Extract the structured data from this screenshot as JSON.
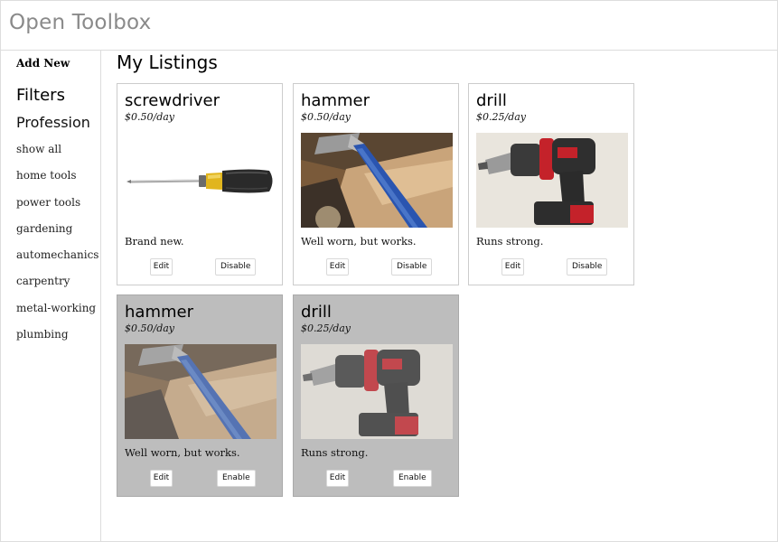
{
  "app": {
    "title": "Open Toolbox"
  },
  "sidebar": {
    "add_new_label": "Add New",
    "filters_title": "Filters",
    "profession_title": "Profession",
    "items": [
      "show all",
      "home tools",
      "power tools",
      "gardening",
      "automechanics",
      "carpentry",
      "metal-working",
      "plumbing"
    ]
  },
  "main": {
    "title": "My Listings",
    "listings": [
      {
        "name": "screwdriver",
        "price": "$0.50/day",
        "description": "Brand new.",
        "image": "screwdriver-photo",
        "edit_label": "Edit",
        "toggle_label": "Disable",
        "disabled": false
      },
      {
        "name": "hammer",
        "price": "$0.50/day",
        "description": "Well worn, but works.",
        "image": "hammer-photo",
        "edit_label": "Edit",
        "toggle_label": "Disable",
        "disabled": false
      },
      {
        "name": "drill",
        "price": "$0.25/day",
        "description": "Runs strong.",
        "image": "drill-photo",
        "edit_label": "Edit",
        "toggle_label": "Disable",
        "disabled": false
      },
      {
        "name": "hammer",
        "price": "$0.50/day",
        "description": "Well worn, but works.",
        "image": "hammer-photo",
        "edit_label": "Edit",
        "toggle_label": "Enable",
        "disabled": true
      },
      {
        "name": "drill",
        "price": "$0.25/day",
        "description": "Runs strong.",
        "image": "drill-photo",
        "edit_label": "Edit",
        "toggle_label": "Enable",
        "disabled": true
      }
    ]
  },
  "colors": {
    "title_gray": "#8a8a8a",
    "disabled_card": "#bdbdbd",
    "border": "#dddddd"
  }
}
